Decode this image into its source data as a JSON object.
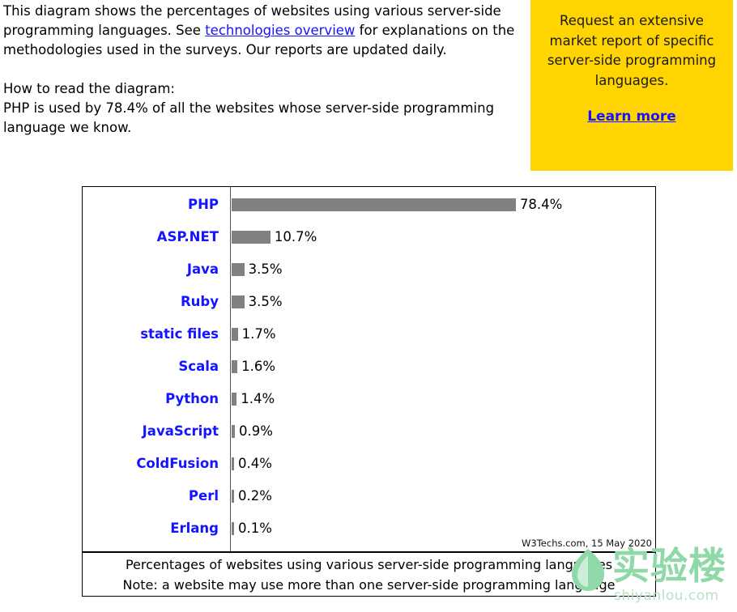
{
  "intro": {
    "paragraph1_part1": "This diagram shows the percentages of websites using various server-side programming languages. See ",
    "link_text": "technologies overview",
    "paragraph1_part2": " for explanations on the methodologies used in the surveys. Our reports are updated daily.",
    "howto_heading": "How to read the diagram:",
    "howto_body": "PHP is used by 78.4% of all the websites whose server-side programming language we know."
  },
  "promo": {
    "text": "Request an extensive market report of specific server-side programming languages.",
    "cta_label": "Learn more",
    "background_color": "#ffd400",
    "link_color": "#1414ff"
  },
  "chart_data": {
    "type": "bar",
    "orientation": "horizontal",
    "title": "Percentages of websites using various server-side programming languages",
    "note": "Note: a website may use more than one server-side programming language",
    "attribution": "W3Techs.com, 15 May 2020",
    "xlabel": "",
    "ylabel": "",
    "xlim": [
      0,
      80
    ],
    "grid": false,
    "legend": "none",
    "bar_color": "#808080",
    "label_color": "#1414ff",
    "categories": [
      "PHP",
      "ASP.NET",
      "Java",
      "Ruby",
      "static files",
      "Scala",
      "Python",
      "JavaScript",
      "ColdFusion",
      "Perl",
      "Erlang"
    ],
    "values": [
      78.4,
      10.7,
      3.5,
      3.5,
      1.7,
      1.6,
      1.4,
      0.9,
      0.4,
      0.2,
      0.1
    ],
    "value_labels": [
      "78.4%",
      "10.7%",
      "3.5%",
      "3.5%",
      "1.7%",
      "1.6%",
      "1.4%",
      "0.9%",
      "0.4%",
      "0.2%",
      "0.1%"
    ]
  },
  "watermark": {
    "cn_text": "实验楼",
    "url_text": "shiyanlou.com",
    "color": "#8fd9a8"
  }
}
